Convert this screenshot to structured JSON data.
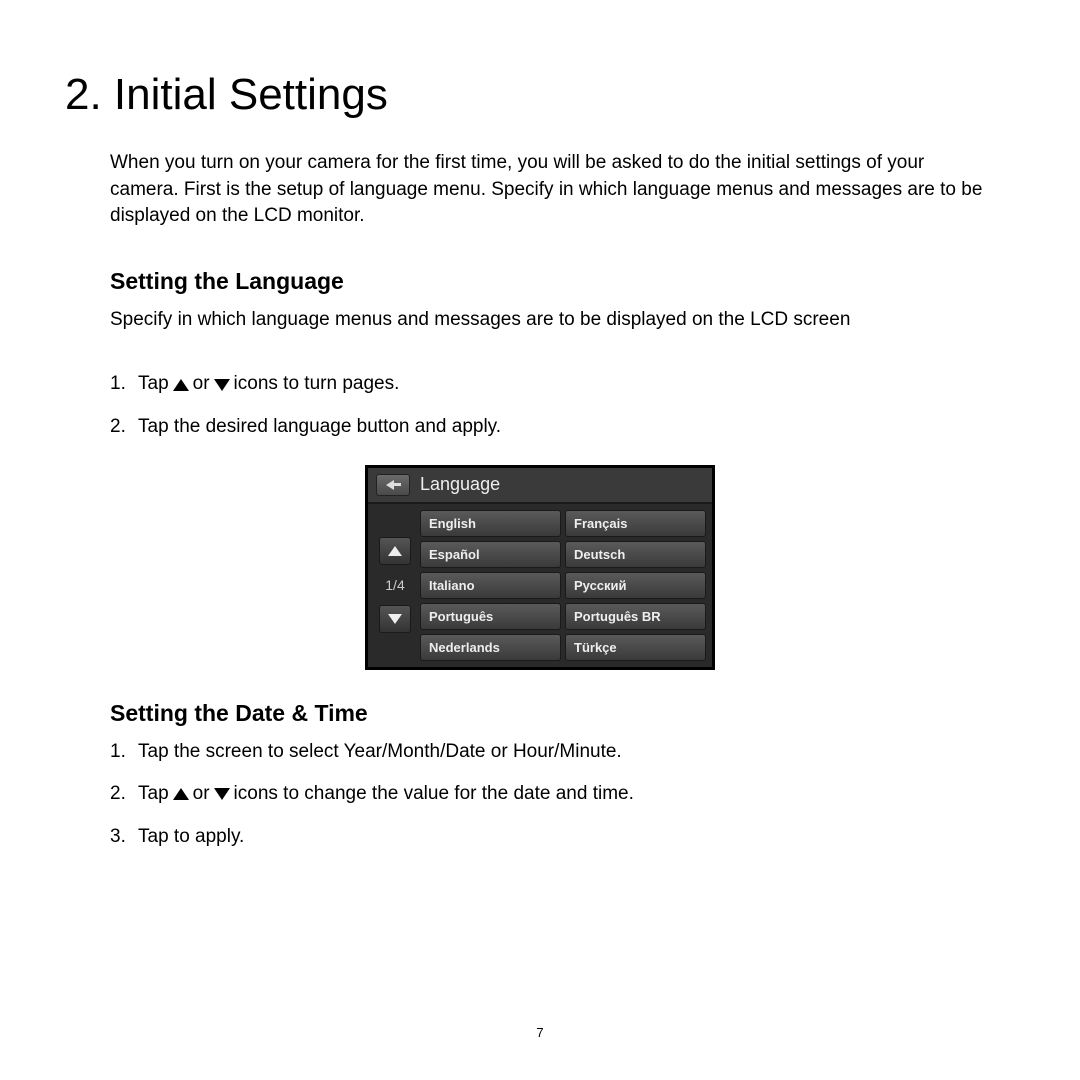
{
  "chapter_title": "2. Initial Settings",
  "intro": "When you turn on your camera for the first time, you will be asked to do the initial settings of your camera. First is the setup of language menu. Specify in which language menus and messages are to be displayed on the LCD monitor.",
  "lang_section": {
    "title": "Setting the Language",
    "desc": "Specify in which language menus and messages are to be displayed on the LCD screen",
    "step1a": "Tap ",
    "step1b": " or ",
    "step1c": " icons to turn pages.",
    "step2": "Tap the desired language button and apply."
  },
  "screen": {
    "title": "Language",
    "page": "1/4",
    "langs": [
      "English",
      "Français",
      "Español",
      "Deutsch",
      "Italiano",
      "Русский",
      "Português",
      "Português BR",
      "Nederlands",
      "Türkçe"
    ]
  },
  "date_section": {
    "title": "Setting the Date & Time",
    "step1": "Tap the screen to select Year/Month/Date or Hour/Minute.",
    "step2a": "Tap ",
    "step2b": " or ",
    "step2c": " icons to change the value for the date and time.",
    "step3": "Tap to apply."
  },
  "page_number": "7"
}
